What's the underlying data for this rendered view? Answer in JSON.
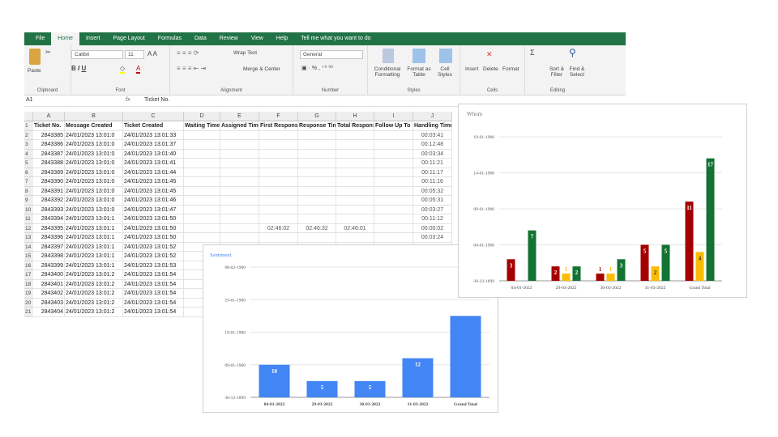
{
  "ribbon": {
    "tabs": [
      "File",
      "Home",
      "Insert",
      "Page Layout",
      "Formulas",
      "Data",
      "Review",
      "View",
      "Help"
    ],
    "tell_me": "Tell me what you want to do",
    "clipboard": {
      "paste": "Paste",
      "label": "Clipboard"
    },
    "font": {
      "name": "Calibri",
      "size": "11",
      "label": "Font"
    },
    "alignment": {
      "wrap": "Wrap Text",
      "merge": "Merge & Center",
      "label": "Alignment"
    },
    "number": {
      "format": "General",
      "label": "Number"
    },
    "styles": {
      "conditional": "Conditional Formatting",
      "format_table": "Format as Table",
      "cell_styles": "Cell Styles",
      "label": "Styles"
    },
    "cells": {
      "insert": "Insert",
      "delete": "Delete",
      "format": "Format",
      "label": "Cells"
    },
    "editing": {
      "sort": "Sort & Filter",
      "find": "Find & Select",
      "label": "Editing"
    }
  },
  "formula_bar": {
    "name_box": "A1",
    "fx": "fx",
    "value": "Ticket No."
  },
  "sheet": {
    "columns": [
      "A",
      "B",
      "C",
      "D",
      "E",
      "F",
      "G",
      "H",
      "I",
      "J"
    ],
    "headers": [
      "Ticket No.",
      "Message Created",
      "Ticket Created",
      "Waiting Time",
      "Assigned Time",
      "First Response",
      "Response Time",
      "Total Response",
      "Follow Up To",
      "Handling Time"
    ],
    "rows": [
      [
        "2843385",
        "24/01/2023 13:01:0",
        "24/01/2023 13:01:33",
        "",
        "",
        "",
        "",
        "",
        "",
        "00:03:41"
      ],
      [
        "2843386",
        "24/01/2023 13:01:0",
        "24/01/2023 13:01:37",
        "",
        "",
        "",
        "",
        "",
        "",
        "00:12:48"
      ],
      [
        "2843387",
        "24/01/2023 13:01:0",
        "24/01/2023 13:01:40",
        "",
        "",
        "",
        "",
        "",
        "",
        "00:03:34"
      ],
      [
        "2843388",
        "24/01/2023 13:01:0",
        "24/01/2023 13:01:41",
        "",
        "",
        "",
        "",
        "",
        "",
        "00:11:21"
      ],
      [
        "2843389",
        "24/01/2023 13:01:0",
        "24/01/2023 13:01:44",
        "",
        "",
        "",
        "",
        "",
        "",
        "00:11:17"
      ],
      [
        "2843390",
        "24/01/2023 13:01:0",
        "24/01/2023 13:01:45",
        "",
        "",
        "",
        "",
        "",
        "",
        "00:11:16"
      ],
      [
        "2843391",
        "24/01/2023 13:01:0",
        "24/01/2023 13:01:45",
        "",
        "",
        "",
        "",
        "",
        "",
        "00:05:32"
      ],
      [
        "2843392",
        "24/01/2023 13:01:0",
        "24/01/2023 13:01:46",
        "",
        "",
        "",
        "",
        "",
        "",
        "00:05:31"
      ],
      [
        "2843393",
        "24/01/2023 13:01:0",
        "24/01/2023 13:01:47",
        "",
        "",
        "",
        "",
        "",
        "",
        "00:03:27"
      ],
      [
        "2843394",
        "24/01/2023 13:01:1",
        "24/01/2023 13:01:50",
        "",
        "",
        "",
        "",
        "",
        "",
        "00:11:12"
      ],
      [
        "2843395",
        "24/01/2023 13:01:1",
        "24/01/2023 13:01:50",
        "",
        "",
        "02:46:02",
        "02:46:32",
        "02:46:01",
        "",
        "00:00:02"
      ],
      [
        "2843396",
        "24/01/2023 13:01:1",
        "24/01/2023 13:01:50",
        "",
        "",
        "",
        "",
        "",
        "",
        "00:03:24"
      ],
      [
        "2843397",
        "24/01/2023 13:01:1",
        "24/01/2023 13:01:52",
        "",
        "",
        "",
        "",
        "",
        "",
        ""
      ],
      [
        "2843398",
        "24/01/2023 13:01:1",
        "24/01/2023 13:01:52",
        "",
        "",
        "",
        "",
        "",
        "",
        ""
      ],
      [
        "2843399",
        "24/01/2023 13:01:1",
        "24/01/2023 13:01:53",
        "",
        "",
        "",
        "",
        "",
        "",
        ""
      ],
      [
        "2843400",
        "24/01/2023 13:01:2",
        "24/01/2023 13:01:54",
        "",
        "",
        "",
        "",
        "",
        "",
        ""
      ],
      [
        "2843401",
        "24/01/2023 13:01:2",
        "24/01/2023 13:01:54",
        "",
        "",
        "",
        "",
        "",
        "",
        ""
      ],
      [
        "2843402",
        "24/01/2023 13:01:2",
        "24/01/2023 13:01:54",
        "",
        "",
        "",
        "",
        "",
        "",
        ""
      ],
      [
        "2843403",
        "24/01/2023 13:01:2",
        "24/01/2023 13:01:54",
        "",
        "",
        "",
        "",
        "",
        "",
        ""
      ],
      [
        "2843404",
        "24/01/2023 13:01:2",
        "24/01/2023 13:01:54",
        "",
        "",
        "",
        "",
        "",
        "",
        ""
      ]
    ]
  },
  "chart_data": [
    {
      "type": "bar",
      "title": "Whom",
      "categories": [
        "04-01-2022",
        "29-03-2022",
        "30-03-2022",
        "31-03-2022",
        "Grand Total"
      ],
      "yticks": [
        "30-12-1899",
        "04-01-1900",
        "09-01-1900",
        "14-01-1900",
        "19-01-1900"
      ],
      "ylim": [
        0,
        20
      ],
      "colors": [
        "#a50000",
        "#fbbc04",
        "#137333"
      ],
      "series": [
        {
          "values": [
            3,
            2,
            1,
            5,
            11
          ]
        },
        {
          "values": [
            0,
            1,
            1,
            2,
            4
          ]
        },
        {
          "values": [
            7,
            2,
            3,
            5,
            17
          ]
        }
      ],
      "grid": true
    },
    {
      "type": "bar",
      "title": "Sentiment",
      "categories": [
        "04-01-2022",
        "29-03-2022",
        "30-03-2022",
        "31-03-2022",
        "Grand Total"
      ],
      "yticks": [
        "30-12-1899",
        "09-01-1900",
        "19-01-1900",
        "29-01-1900",
        "08-02-1900"
      ],
      "ylim": [
        0,
        40
      ],
      "colors": [
        "#4285f4"
      ],
      "series": [
        {
          "values": [
            10,
            5,
            5,
            12,
            25
          ],
          "labels": [
            "10",
            "5",
            "5",
            "12",
            ""
          ]
        }
      ],
      "grid": true
    }
  ]
}
